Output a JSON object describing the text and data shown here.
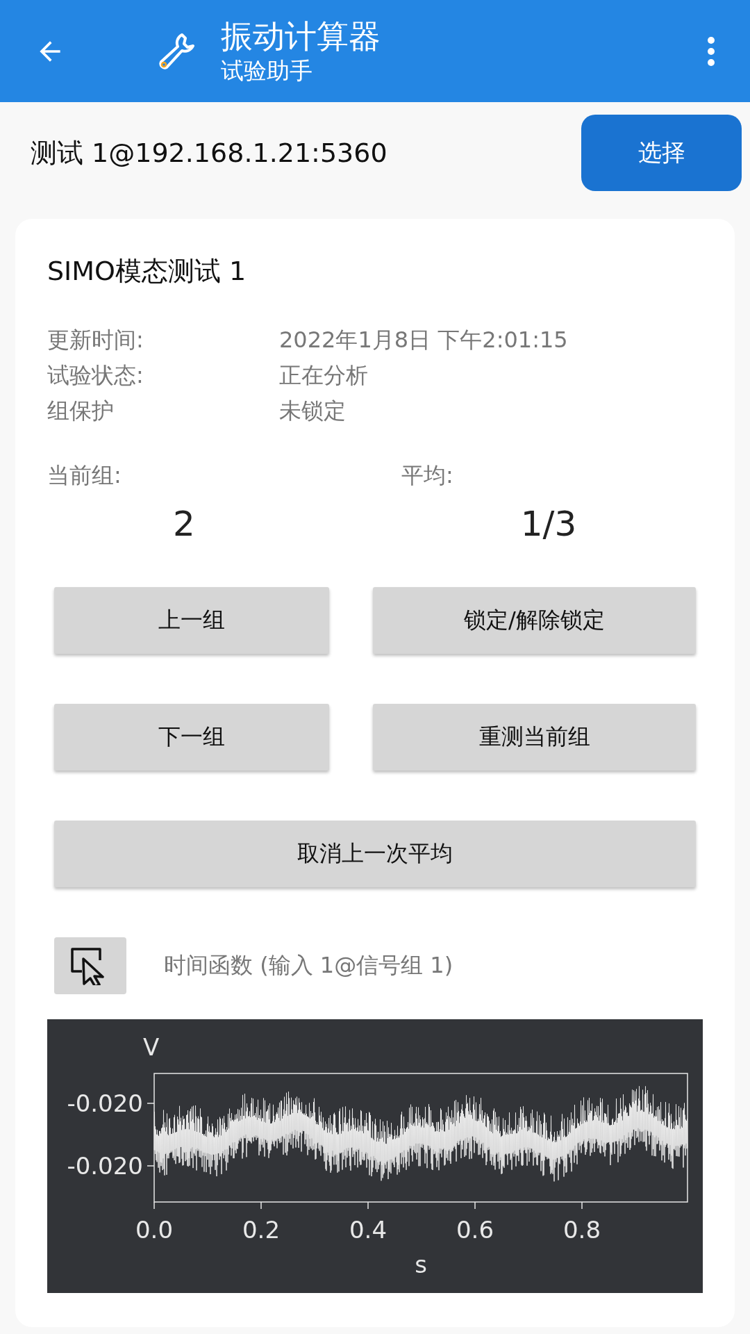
{
  "app_bar": {
    "title": "振动计算器",
    "subtitle": "试验助手"
  },
  "connection": {
    "label": "测试 1@192.168.1.21:5360",
    "button": "选择"
  },
  "card": {
    "title": "SIMO模态测试 1",
    "info": [
      {
        "label": "更新时间:",
        "value": "2022年1月8日 下午2:01:15"
      },
      {
        "label": "试验状态:",
        "value": "正在分析"
      },
      {
        "label": "组保护",
        "value": "未锁定"
      }
    ],
    "stats": [
      {
        "label": "当前组:",
        "value": "2"
      },
      {
        "label": "平均:",
        "value": "1/3"
      }
    ],
    "buttons": [
      "上一组",
      "锁定/解除锁定",
      "下一组",
      "重测当前组",
      "取消上一次平均"
    ],
    "plot_caption": "时间函数 (输入 1@信号组 1)",
    "plot": {
      "ylabel": "V",
      "xlabel": "s",
      "yticks": [
        "-0.020",
        "-0.020"
      ],
      "xticks": [
        "0.0",
        "0.2",
        "0.4",
        "0.6",
        "0.8"
      ]
    }
  }
}
